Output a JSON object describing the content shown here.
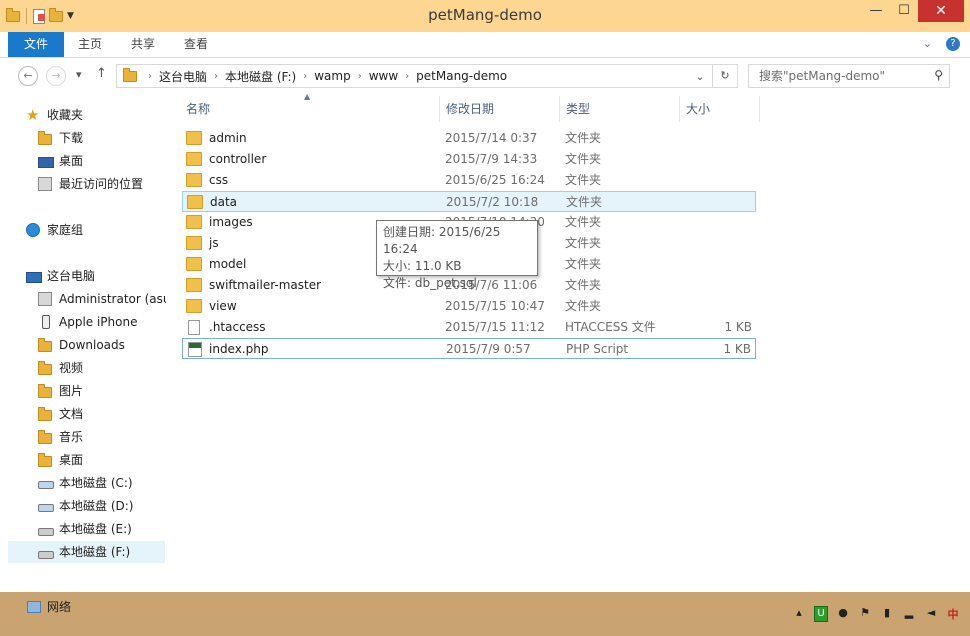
{
  "window": {
    "title": "petMang-demo",
    "controls": {
      "minimize": "—",
      "maximize": "☐",
      "close": "✕"
    }
  },
  "ribbon": {
    "tabs": [
      "文件",
      "主页",
      "共享",
      "查看"
    ],
    "right_icons": [
      "chevron-down-icon",
      "help-icon"
    ]
  },
  "address": {
    "crumbs": [
      "这台电脑",
      "本地磁盘 (F:)",
      "wamp",
      "www",
      "petMang-demo"
    ],
    "search_placeholder": "搜索\"petMang-demo\""
  },
  "nav": {
    "favorites": {
      "label": "收藏夹",
      "items": [
        "下载",
        "桌面",
        "最近访问的位置"
      ]
    },
    "homegroup": "家庭组",
    "thispc": {
      "label": "这台电脑",
      "items": [
        "Administrator (asu",
        "Apple iPhone",
        "Downloads",
        "视频",
        "图片",
        "文档",
        "音乐",
        "桌面",
        "本地磁盘 (C:)",
        "本地磁盘 (D:)",
        "本地磁盘 (E:)",
        "本地磁盘 (F:)"
      ]
    },
    "network": "网络"
  },
  "columns": {
    "name": "名称",
    "date": "修改日期",
    "type": "类型",
    "size": "大小"
  },
  "files": [
    {
      "name": "admin",
      "date": "2015/7/14 0:37",
      "type": "文件夹",
      "size": "",
      "kind": "folder"
    },
    {
      "name": "controller",
      "date": "2015/7/9 14:33",
      "type": "文件夹",
      "size": "",
      "kind": "folder"
    },
    {
      "name": "css",
      "date": "2015/6/25 16:24",
      "type": "文件夹",
      "size": "",
      "kind": "folder"
    },
    {
      "name": "data",
      "date": "2015/7/2 10:18",
      "type": "文件夹",
      "size": "",
      "kind": "folder"
    },
    {
      "name": "images",
      "date": "2015/7/10 14:30",
      "type": "文件夹",
      "size": "",
      "kind": "folder"
    },
    {
      "name": "js",
      "date": "",
      "type": "文件夹",
      "size": "",
      "kind": "folder"
    },
    {
      "name": "model",
      "date": "",
      "type": "文件夹",
      "size": "",
      "kind": "folder"
    },
    {
      "name": "swiftmailer-master",
      "date": "2015/7/6 11:06",
      "type": "文件夹",
      "size": "",
      "kind": "folder"
    },
    {
      "name": "view",
      "date": "2015/7/15 10:47",
      "type": "文件夹",
      "size": "",
      "kind": "folder"
    },
    {
      "name": ".htaccess",
      "date": "2015/7/15 11:12",
      "type": "HTACCESS 文件",
      "size": "1 KB",
      "kind": "file"
    },
    {
      "name": "index.php",
      "date": "2015/7/9 0:57",
      "type": "PHP Script",
      "size": "1 KB",
      "kind": "php"
    }
  ],
  "tooltip": {
    "created": "创建日期: 2015/6/25 16:24",
    "size": "大小: 11.0 KB",
    "file": "文件: db_pet.sql"
  }
}
